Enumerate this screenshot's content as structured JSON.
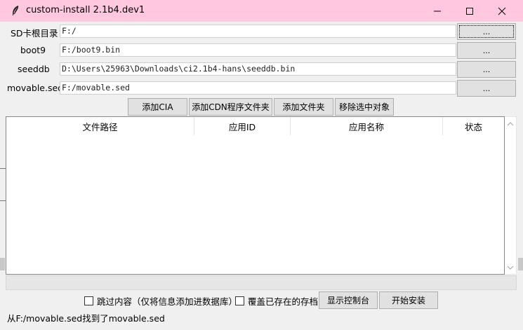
{
  "window": {
    "title": "custom-install 2.1b4.dev1",
    "icon": "feather-icon",
    "titlebar_color": "#ffc8e0"
  },
  "paths": [
    {
      "label": "SD卡根目录",
      "value": "F:/",
      "browse_label": "..."
    },
    {
      "label": "boot9",
      "value": "F:/boot9.bin",
      "browse_label": "..."
    },
    {
      "label": "seeddb",
      "value": "D:\\Users\\25963\\Downloads\\ci2.1b4-hans\\seeddb.bin",
      "browse_label": "..."
    },
    {
      "label": "movable.sed",
      "value": "F:/movable.sed",
      "browse_label": "..."
    }
  ],
  "actions": {
    "add_cia": "添加CIA",
    "add_cdn_folder": "添加CDN程序文件夹",
    "add_folder": "添加文件夹",
    "remove_selected": "移除选中对象"
  },
  "table": {
    "columns": [
      "文件路径",
      "应用ID",
      "应用名称",
      "状态"
    ],
    "rows": []
  },
  "options": {
    "skip_contents": {
      "label": "跳过内容（仅将信息添加进数据库）",
      "checked": false
    },
    "overwrite_saves": {
      "label": "覆盖已存在的存档",
      "checked": false
    }
  },
  "buttons": {
    "show_console": "显示控制台",
    "start_install": "开始安装"
  },
  "status": "从F:/movable.sed找到了movable.sed"
}
